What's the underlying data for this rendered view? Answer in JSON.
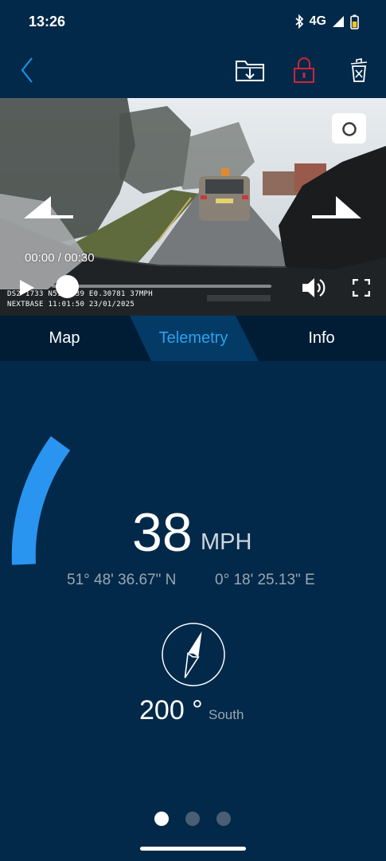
{
  "status_bar": {
    "time": "13:26",
    "network": "4G",
    "icons": [
      "bluetooth-icon",
      "signal-icon",
      "battery-icon"
    ]
  },
  "toolbar": {
    "back_icon": "chevron-left-icon",
    "download_icon": "folder-download-icon",
    "lock_icon": "lock-icon",
    "delete_icon": "trash-icon",
    "accent_color": "#1e8fe1",
    "lock_color": "#d0233a"
  },
  "video": {
    "time_display": "00:00 / 00:30",
    "overlay_line1": "DS2 1733 N51.8639 E0.30781 37MPH",
    "overlay_line2": "NEXTBASE 11:01:50 23/01/2025",
    "progress": 0.0,
    "controls": [
      "play-icon",
      "volume-icon",
      "fullscreen-icon",
      "camera-icon",
      "prev-clip-icon",
      "next-clip-icon"
    ]
  },
  "tabs": {
    "items": [
      {
        "label": "Map"
      },
      {
        "label": "Telemetry"
      },
      {
        "label": "Info"
      }
    ],
    "active_index": 1,
    "active_color": "#2aa3e8"
  },
  "telemetry": {
    "speed": "38",
    "speed_unit": "MPH",
    "latitude": "51° 48' 36.67\" N",
    "longitude": "0° 18' 25.13\" E",
    "heading": "200 °",
    "heading_direction": "South",
    "speed_gauge_color": "#2a95f0"
  },
  "pager": {
    "count": 3,
    "active_index": 0
  }
}
